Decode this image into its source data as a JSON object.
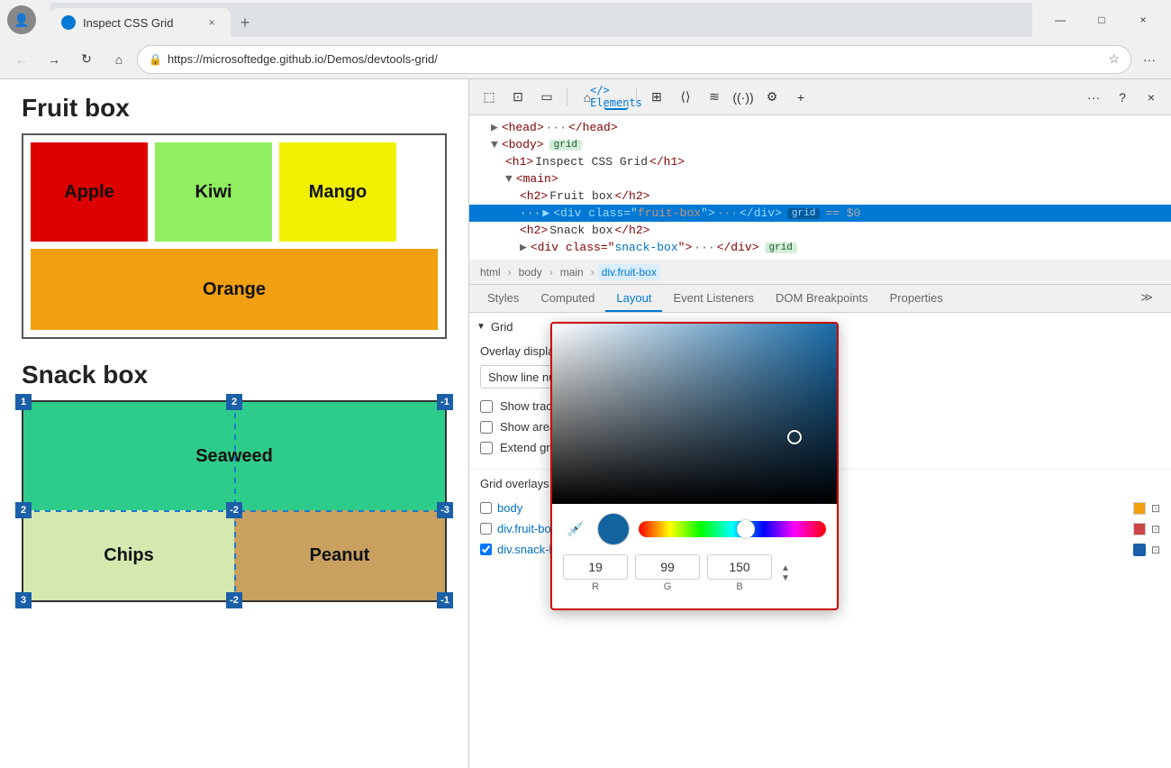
{
  "browser": {
    "tab_title": "Inspect CSS Grid",
    "tab_close": "×",
    "tab_add": "+",
    "url": "https://microsoftedge.github.io/Demos/devtools-grid/",
    "nav_back": "←",
    "nav_forward": "→",
    "nav_reload": "↻",
    "nav_home": "⌂",
    "nav_search": "🔍",
    "win_minimize": "—",
    "win_maximize": "□",
    "win_close": "×",
    "more_tools": "···",
    "settings": "?"
  },
  "webpage": {
    "fruit_box_title": "Fruit box",
    "snack_box_title": "Snack box",
    "fruits": {
      "apple": "Apple",
      "kiwi": "Kiwi",
      "mango": "Mango",
      "orange": "Orange"
    },
    "snacks": {
      "seaweed": "Seaweed",
      "chips": "Chips",
      "peanut": "Peanut"
    }
  },
  "devtools": {
    "toolbar_icons": [
      "inspect",
      "device",
      "split",
      "home",
      "elements",
      "console",
      "sources",
      "network",
      "performance",
      "memory",
      "application",
      "more",
      "settings",
      "close"
    ],
    "elements_tab": "Elements",
    "dom": {
      "line1": "▶ <head>··· </head>",
      "line2": "▼ <body>",
      "line2_badge": "grid",
      "line3": "<h1>Inspect CSS Grid</h1>",
      "line4": "▼ <main>",
      "line5": "<h2>Fruit box</h2>",
      "line6_pre": "▶ <div class=\"fruit-box\">",
      "line6_dots": "···",
      "line6_post": "</div>",
      "line6_badge": "grid",
      "line6_selected": true,
      "line7": "<h2>Snack box</h2>",
      "line8_pre": "▶ <div class=\"snack-box\">",
      "line8_dots": "···",
      "line8_post": "</div>",
      "line8_badge": "grid"
    },
    "breadcrumb": [
      "html",
      "body",
      "main",
      "div.fruit-box"
    ],
    "panel_tabs": [
      "Styles",
      "Computed",
      "Layout",
      "Event Listeners",
      "DOM Breakpoints",
      "Properties"
    ],
    "active_panel_tab": "Layout",
    "grid_section_header": "Grid",
    "overlay_display_label": "Overlay display settings",
    "overlay_dropdown": "Show line numbers",
    "checkboxes": [
      {
        "label": "Show track sizes",
        "checked": false
      },
      {
        "label": "Show area names",
        "checked": false
      },
      {
        "label": "Extend grid lines",
        "checked": false
      }
    ],
    "grid_overlays_title": "Grid overlays",
    "grid_overlays": [
      {
        "label": "body",
        "color": "#f0a010",
        "checked": false
      },
      {
        "label": "div.fruit-box",
        "color": "#cc4444",
        "checked": false
      },
      {
        "label": "div.snack-box",
        "color": "#1a5fa8",
        "checked": true
      }
    ]
  },
  "color_picker": {
    "r_value": "19",
    "g_value": "99",
    "b_value": "150",
    "r_label": "R",
    "g_label": "G",
    "b_label": "B"
  }
}
